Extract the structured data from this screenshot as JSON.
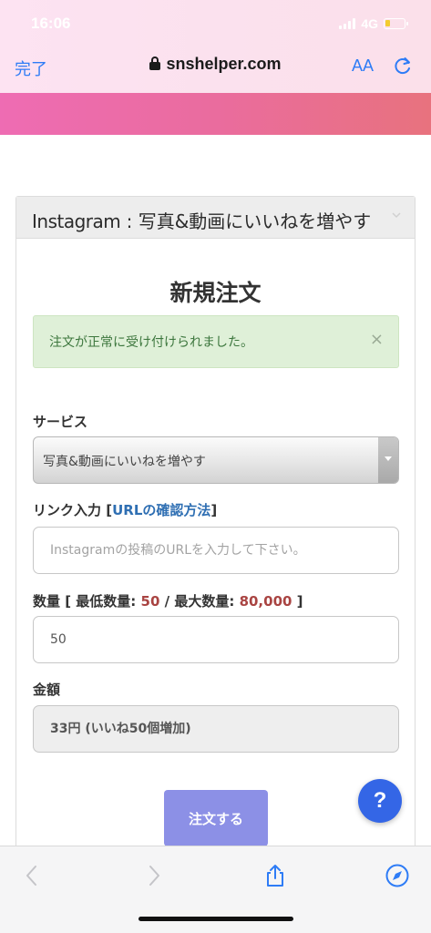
{
  "status": {
    "time": "16:06",
    "network": "4G"
  },
  "browser": {
    "done_label": "完了",
    "url": "snshelper.com",
    "text_size_label": "AA"
  },
  "panel": {
    "title_brand": "Instagram",
    "title_sep": " : ",
    "title_service": "写真&動画にいいねを増やす"
  },
  "form": {
    "title": "新規注文",
    "alert_text": "注文が正常に受け付けられました。",
    "alert_close": "×",
    "service_label": "サービス",
    "service_value": "写真&動画にいいねを増やす",
    "link_label": "リンク入力 [",
    "link_help": "URLの確認方法",
    "link_label_end": "]",
    "link_placeholder": "Instagramの投稿のURLを入力して下さい。",
    "qty_label_a": "数量 [ 最低数量: ",
    "qty_min": "50",
    "qty_label_b": " / 最大数量: ",
    "qty_max": "80,000",
    "qty_label_c": " ]",
    "qty_value": "50",
    "price_label": "金額",
    "price_value": "33円 (いいね50個増加)",
    "submit_label": "注文する"
  },
  "help_button": "?",
  "icons": {
    "back": "chevron-left-icon",
    "forward": "chevron-right-icon",
    "share": "share-icon",
    "compass": "compass-icon",
    "reload": "reload-icon",
    "lock": "lock-icon"
  },
  "colors": {
    "header_gradient_start": "#ee6cb3",
    "header_gradient_end": "#e8727e",
    "submit": "#8c90e6",
    "help": "#3466e6",
    "alert_bg": "#dff0d8",
    "alert_text": "#3c763d",
    "accent_red": "#a94442",
    "link": "#2f6fb3"
  }
}
